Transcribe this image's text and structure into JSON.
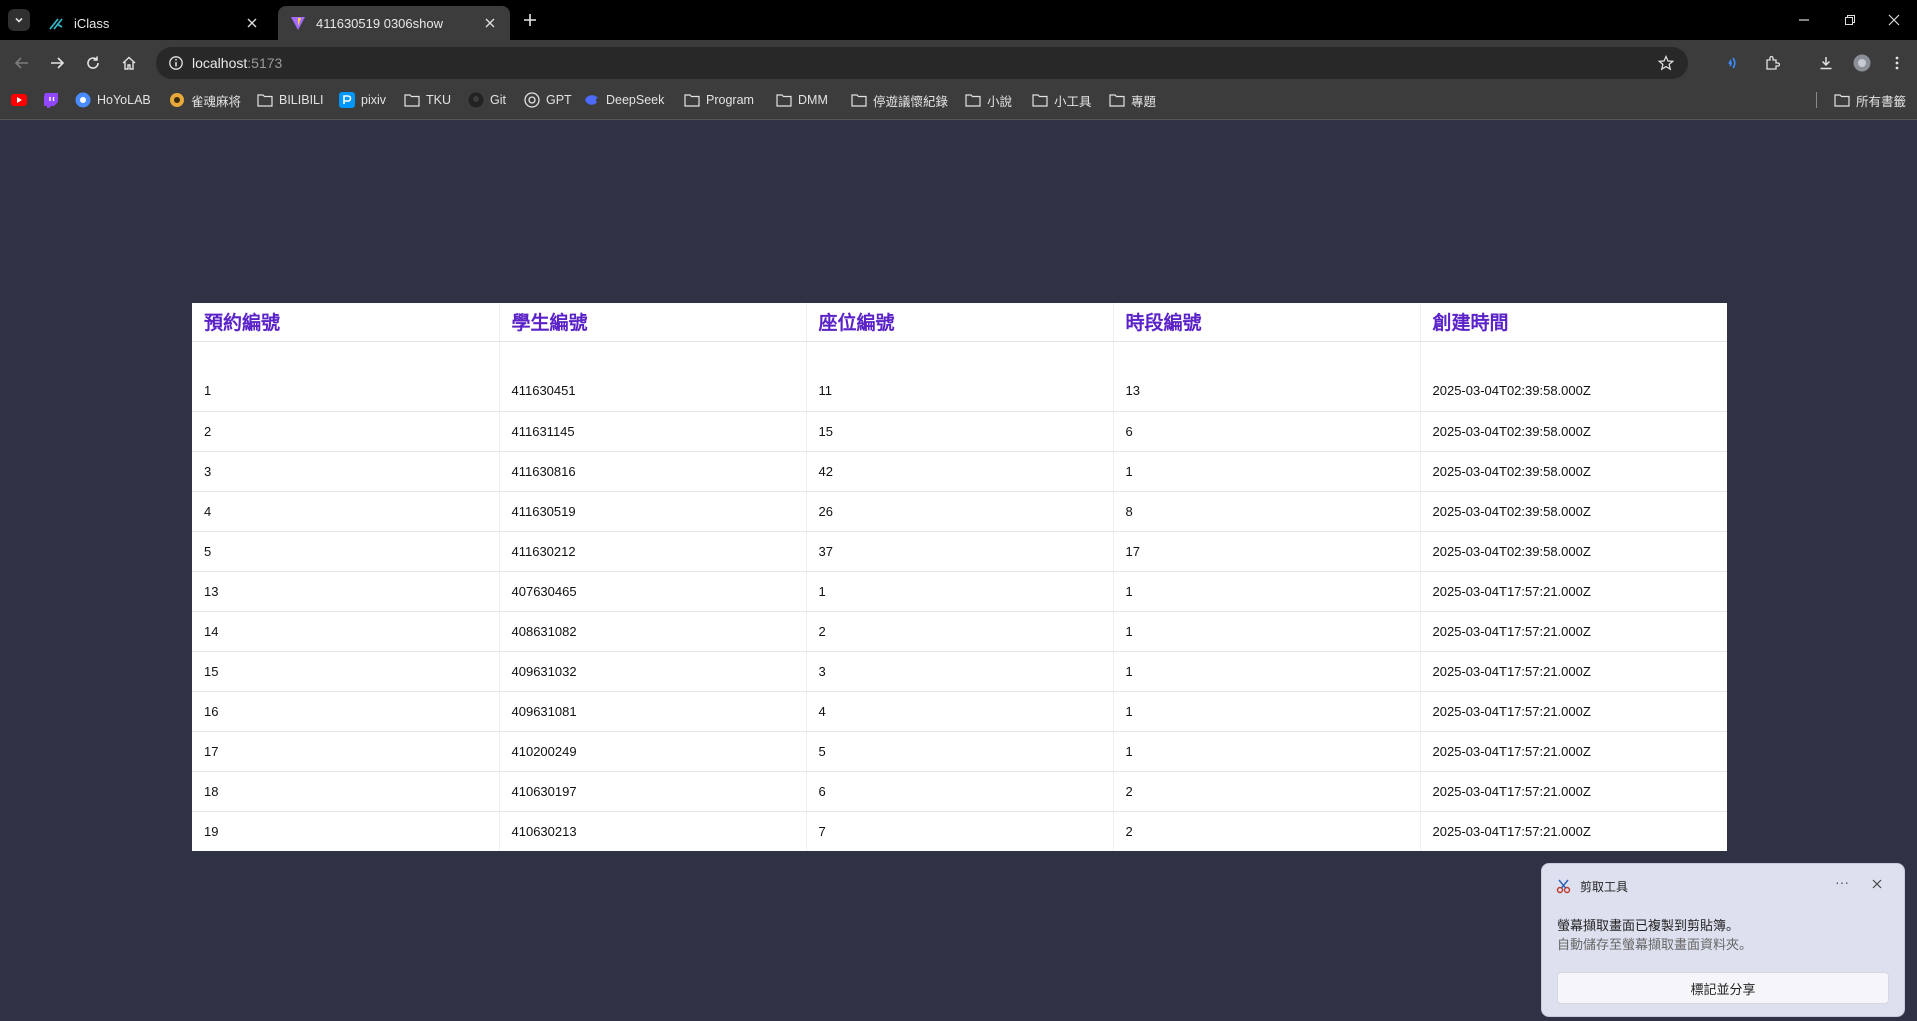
{
  "browser": {
    "tabs": [
      {
        "title": "iClass",
        "icon": "iclass-icon",
        "active": false
      },
      {
        "title": "411630519 0306show",
        "icon": "vite-icon",
        "active": true
      }
    ],
    "address": {
      "host": "localhost",
      "port": ":5173"
    },
    "bookmarks": [
      {
        "label": "",
        "icon": "youtube-icon"
      },
      {
        "label": "",
        "icon": "twitch-icon"
      },
      {
        "label": "HoYoLAB",
        "icon": "hoyolab-icon"
      },
      {
        "label": "雀魂麻将",
        "icon": "mahjong-icon"
      },
      {
        "label": "BILIBILI",
        "icon": "folder-icon"
      },
      {
        "label": "pixiv",
        "icon": "pixiv-icon"
      },
      {
        "label": "TKU",
        "icon": "folder-icon"
      },
      {
        "label": "Git",
        "icon": "github-icon"
      },
      {
        "label": "GPT",
        "icon": "openai-icon"
      },
      {
        "label": "DeepSeek",
        "icon": "deepseek-icon"
      },
      {
        "label": "Program",
        "icon": "folder-icon"
      },
      {
        "label": "DMM",
        "icon": "folder-icon"
      },
      {
        "label": "停遊議懷紀錄",
        "icon": "folder-icon"
      },
      {
        "label": "小說",
        "icon": "folder-icon"
      },
      {
        "label": "小工具",
        "icon": "folder-icon"
      },
      {
        "label": "專題",
        "icon": "folder-icon"
      }
    ],
    "all_bookmarks": "所有書籤"
  },
  "table": {
    "headers": [
      "預約編號",
      "學生編號",
      "座位編號",
      "時段編號",
      "創建時間"
    ],
    "rows": [
      [
        "1",
        "411630451",
        "11",
        "13",
        "2025-03-04T02:39:58.000Z"
      ],
      [
        "2",
        "411631145",
        "15",
        "6",
        "2025-03-04T02:39:58.000Z"
      ],
      [
        "3",
        "411630816",
        "42",
        "1",
        "2025-03-04T02:39:58.000Z"
      ],
      [
        "4",
        "411630519",
        "26",
        "8",
        "2025-03-04T02:39:58.000Z"
      ],
      [
        "5",
        "411630212",
        "37",
        "17",
        "2025-03-04T02:39:58.000Z"
      ],
      [
        "13",
        "407630465",
        "1",
        "1",
        "2025-03-04T17:57:21.000Z"
      ],
      [
        "14",
        "408631082",
        "2",
        "1",
        "2025-03-04T17:57:21.000Z"
      ],
      [
        "15",
        "409631032",
        "3",
        "1",
        "2025-03-04T17:57:21.000Z"
      ],
      [
        "16",
        "409631081",
        "4",
        "1",
        "2025-03-04T17:57:21.000Z"
      ],
      [
        "17",
        "410200249",
        "5",
        "1",
        "2025-03-04T17:57:21.000Z"
      ],
      [
        "18",
        "410630197",
        "6",
        "2",
        "2025-03-04T17:57:21.000Z"
      ],
      [
        "19",
        "410630213",
        "7",
        "2",
        "2025-03-04T17:57:21.000Z"
      ]
    ]
  },
  "toast": {
    "app": "剪取工具",
    "more": "···",
    "message": "螢幕擷取畫面已複製到剪貼簿。",
    "sub": "自動儲存至螢幕擷取畫面資料夾。",
    "action": "標記並分享"
  },
  "colors": {
    "page_bg": "#2f3244",
    "header_text": "#5b22c8"
  }
}
